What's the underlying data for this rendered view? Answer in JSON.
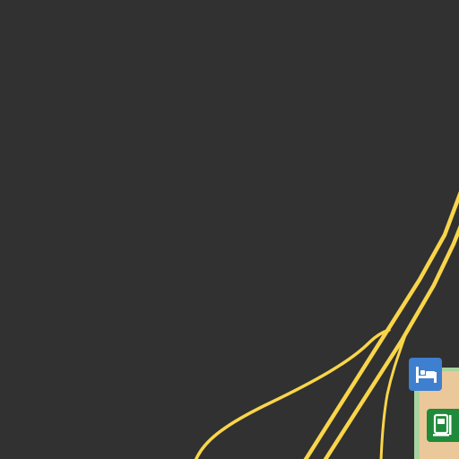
{
  "map": {
    "background_color": "#313131",
    "road_color": "#f9d54a",
    "road_casing_color": "#c9a93a",
    "park_color": "#a8d3a0",
    "building_color": "#eac89a",
    "pois": [
      {
        "kind": "lodging",
        "icon": "bed-icon",
        "color": "#3f7fd0"
      },
      {
        "kind": "transit",
        "icon": "bus-stop-icon",
        "color": "#1f8a3a"
      }
    ]
  }
}
